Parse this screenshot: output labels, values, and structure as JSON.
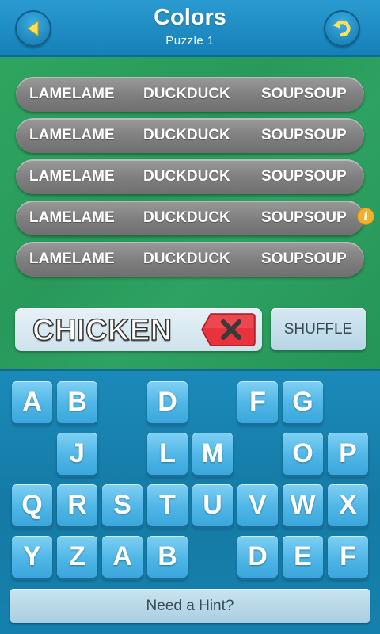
{
  "header": {
    "title": "Colors",
    "subtitle": "Puzzle 1",
    "back_icon": "back-arrow-icon",
    "reset_icon": "undo-arrow-icon"
  },
  "rows": [
    [
      "LAMELAME",
      "DUCKDUCK",
      "SOUPSOUP"
    ],
    [
      "LAMELAME",
      "DUCKDUCK",
      "SOUPSOUP"
    ],
    [
      "LAMELAME",
      "DUCKDUCK",
      "SOUPSOUP"
    ],
    [
      "LAMELAME",
      "DUCKDUCK",
      "SOUPSOUP"
    ],
    [
      "LAMELAME",
      "DUCKDUCK",
      "SOUPSOUP"
    ]
  ],
  "info_icon": "i",
  "entry": {
    "text": "CHICKEN",
    "clear_icon": "clear-x-icon"
  },
  "shuffle_label": "SHUFFLE",
  "keys": [
    [
      "A",
      "B",
      "",
      "D",
      "",
      "F",
      "G",
      ""
    ],
    [
      "",
      "J",
      "",
      "L",
      "M",
      "",
      "O",
      "P"
    ],
    [
      "Q",
      "R",
      "S",
      "T",
      "U",
      "V",
      "W",
      "X"
    ],
    [
      "Y",
      "Z",
      "A",
      "B",
      "",
      "D",
      "E",
      "F"
    ]
  ],
  "hint_label": "Need a Hint?",
  "colors": {
    "header": "#1e8cc4",
    "board": "#2a9c5c",
    "key": "#4fb6e6",
    "clear": "#e8333c",
    "info": "#f2b12a"
  }
}
